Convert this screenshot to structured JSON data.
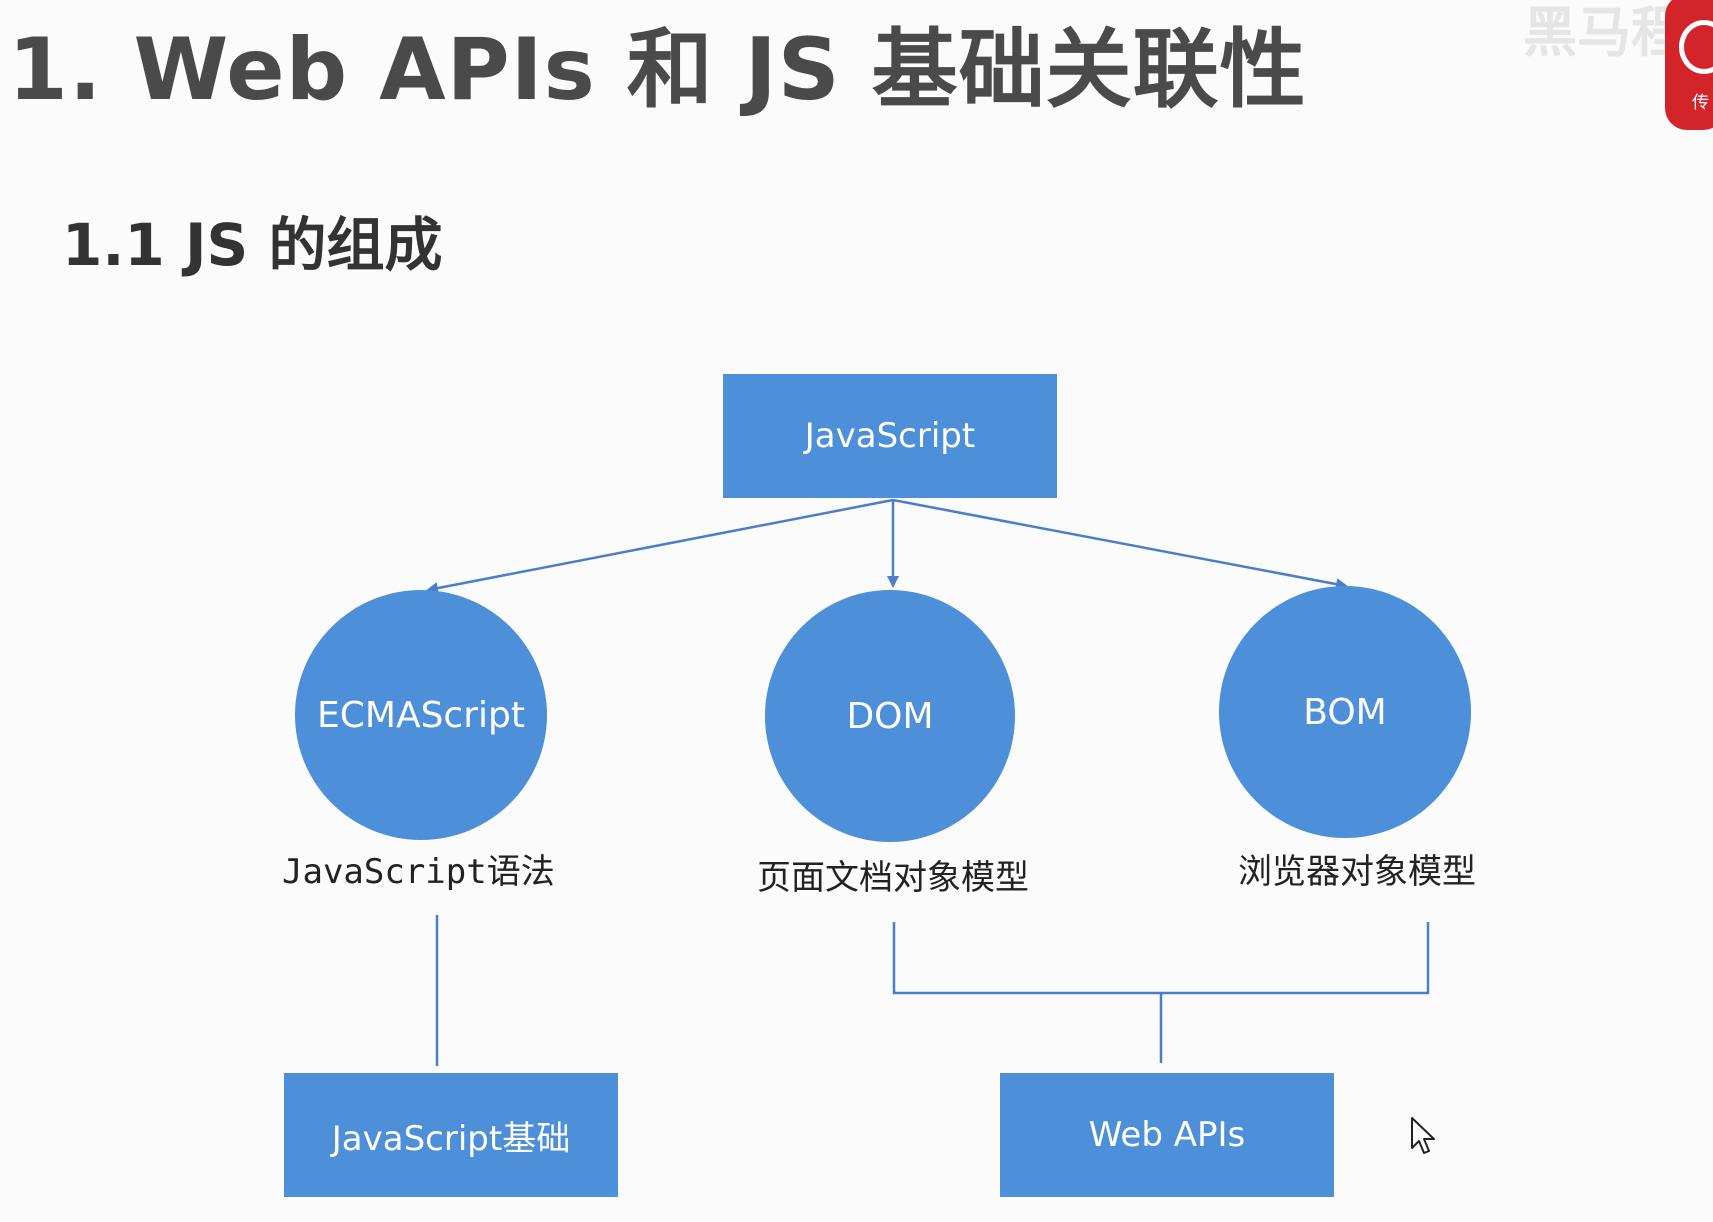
{
  "page": {
    "title": "1. Web APIs 和 JS 基础关联性",
    "subtitle": "1.1 JS 的组成"
  },
  "diagram": {
    "root": "JavaScript",
    "nodes": [
      {
        "id": "ecmascript",
        "label": "ECMAScript",
        "caption": "JavaScript语法"
      },
      {
        "id": "dom",
        "label": "DOM",
        "caption": "页面文档对象模型"
      },
      {
        "id": "bom",
        "label": "BOM",
        "caption": "浏览器对象模型"
      }
    ],
    "groups": [
      {
        "id": "js-basics",
        "label": "JavaScript基础",
        "members": [
          "ecmascript"
        ]
      },
      {
        "id": "web-apis",
        "label": "Web APIs",
        "members": [
          "dom",
          "bom"
        ]
      }
    ]
  },
  "colors": {
    "node_fill": "#4d8fd8",
    "node_text": "#ffffff",
    "connector": "#4a7fc8",
    "title_text": "#4a4a4a",
    "logo": "#d3242a"
  },
  "icons": {
    "logo": "brand-badge-icon",
    "pointer": "mouse-pointer-icon"
  }
}
